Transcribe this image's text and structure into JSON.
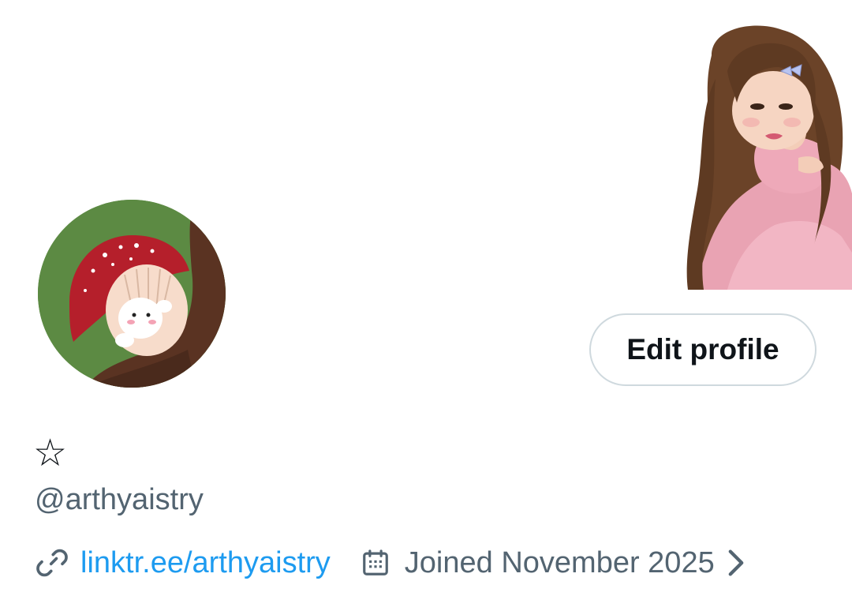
{
  "profile": {
    "display_name": "☆",
    "handle": "@arthyaistry",
    "website": "linktr.ee/arthyaistry",
    "joined": "Joined November 2025"
  },
  "actions": {
    "edit_profile_label": "Edit profile"
  },
  "icons": {
    "website": "link-icon",
    "joined": "calendar-icon",
    "more": "chevron-right-icon"
  },
  "colors": {
    "link": "#1d9bf0",
    "secondary_text": "#536471",
    "primary_text": "#0f1419",
    "button_border": "#cfd9de"
  }
}
